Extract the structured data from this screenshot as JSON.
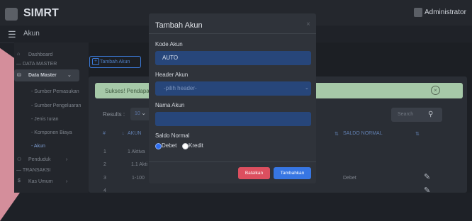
{
  "header": {
    "brand": "SIMRT",
    "user": "Administrator"
  },
  "breadcrumb": {
    "label": "Akun"
  },
  "sidebar": {
    "items": [
      {
        "label": "Dashboard"
      },
      {
        "label": "DATA MASTER"
      },
      {
        "label": "Data Master"
      },
      {
        "label": "- Sumber Pemasukan"
      },
      {
        "label": "- Sumber Pengeluaran"
      },
      {
        "label": "- Jenis Iuran"
      },
      {
        "label": "- Komponen Biaya"
      },
      {
        "label": "- Akun"
      },
      {
        "label": "Penduduk"
      },
      {
        "label": "TRANSAKSI"
      },
      {
        "label": "Kas Umum"
      }
    ]
  },
  "page": {
    "add_button": "Tambah Akun"
  },
  "alert": {
    "text": "Sukses! Pendapatan"
  },
  "table": {
    "results_label": "Results :",
    "results_value": "10",
    "search_placeholder": "Search",
    "headers": [
      "#",
      "AKUN",
      "SALDO NORMAL"
    ],
    "rows": [
      {
        "no": "1",
        "akun": "1 Aktiva",
        "saldo": ""
      },
      {
        "no": "2",
        "akun": "1.1 Akti",
        "saldo": ""
      },
      {
        "no": "3",
        "akun": "1-100",
        "saldo": "Debet"
      },
      {
        "no": "4",
        "akun": "",
        "saldo": ""
      }
    ]
  },
  "modal": {
    "title": "Tambah Akun",
    "close": "×",
    "kode_label": "Kode Akun",
    "kode_value": "AUTO",
    "header_label": "Header Akun",
    "header_placeholder": "-pilih header-",
    "nama_label": "Nama Akun",
    "nama_value": "",
    "saldo_label": "Saldo Normal",
    "option_debet": "Debet",
    "option_kredit": "Kredit",
    "selected": "Debet",
    "cancel_button": "Batalkan",
    "submit_button": "Tambahkan"
  },
  "colors": {
    "primary": "#3776e3",
    "danger": "#dc4f5f",
    "success_bg": "#a6c9a8"
  }
}
